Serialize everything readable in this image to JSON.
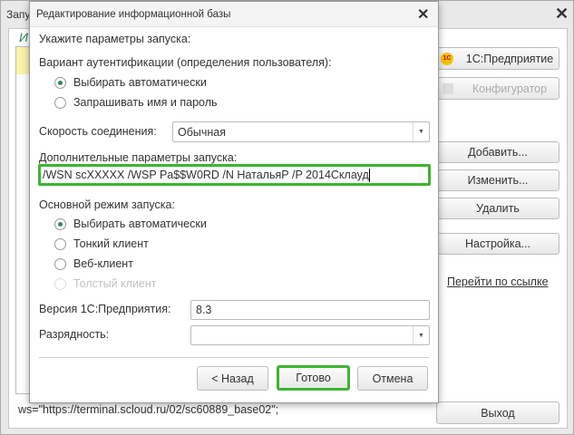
{
  "background_window": {
    "title": "Запу",
    "list_header": "И",
    "buttons": {
      "enterprise": "1С:Предприятие",
      "configurator": "Конфигуратор",
      "add": "Добавить...",
      "edit": "Изменить...",
      "delete": "Удалить",
      "settings": "Настройка...",
      "exit": "Выход"
    },
    "link": "Перейти по ссылке",
    "connection_string": "ws=\"https://terminal.scloud.ru/02/sc60889_base02\";"
  },
  "dialog": {
    "title": "Редактирование информационной базы",
    "heading": "Укажите параметры запуска:",
    "auth_label": "Вариант аутентификации (определения пользователя):",
    "auth_options": [
      {
        "label": "Выбирать автоматически",
        "selected": true
      },
      {
        "label": "Запрашивать имя и пароль",
        "selected": false
      }
    ],
    "speed_label": "Скорость соединения:",
    "speed_value": "Обычная",
    "extra_label": "Дополнительные параметры запуска:",
    "extra_value": "/WSN scXXXXX /WSP Pa$$W0RD /N НатальяР /P 2014Склауд",
    "mode_label": "Основной режим запуска:",
    "mode_options": [
      {
        "label": "Выбирать автоматически",
        "selected": true,
        "disabled": false
      },
      {
        "label": "Тонкий клиент",
        "selected": false,
        "disabled": false
      },
      {
        "label": "Веб-клиент",
        "selected": false,
        "disabled": false
      },
      {
        "label": "Толстый клиент",
        "selected": false,
        "disabled": true
      }
    ],
    "version_label": "Версия 1С:Предприятия:",
    "version_value": "8.3",
    "bitness_label": "Разрядность:",
    "bitness_value": "",
    "buttons": {
      "back": "< Назад",
      "finish": "Готово",
      "cancel": "Отмена"
    },
    "highlight_color": "#3cb531"
  }
}
